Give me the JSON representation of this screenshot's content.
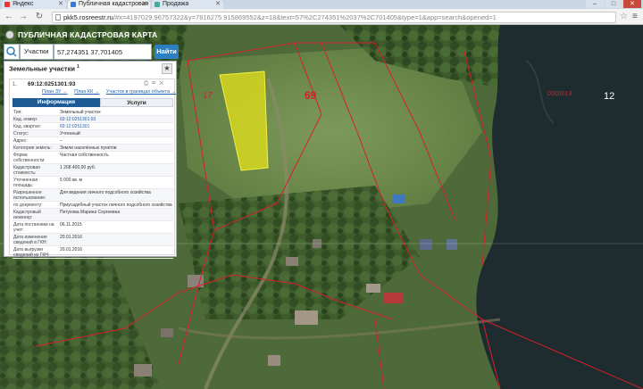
{
  "browser": {
    "tabs": [
      {
        "label": "Яндекс",
        "active": false
      },
      {
        "label": "Публичная кадастровая",
        "active": true
      },
      {
        "label": "Продажа",
        "active": false
      }
    ],
    "controls": {
      "minimize": "–",
      "maximize": "□",
      "close": "✕"
    },
    "url_host": "pkk5.rosreestr.ru",
    "url_rest": "/#x=4197029.96757322&y=7816275.915869552&z=18&text=57%2C274351%2037%2C701405&type=1&app=search&opened=1"
  },
  "map_header": {
    "title": "ПУБЛИЧНАЯ КАДАСТРОВАЯ КАРТА"
  },
  "search": {
    "type": "Участки ▾",
    "value": "57,274351 37,701405",
    "button": "Найти"
  },
  "panel": {
    "title": "Земельные участки",
    "count": "1",
    "object": {
      "num": "1.",
      "id": "69:12:0251301:93",
      "tools": "⎙ ✉ ✕",
      "links": [
        "План ЗУ →",
        "План КК →",
        "Участок в границах объекта →"
      ]
    },
    "tabs": {
      "info": "Информация",
      "services": "Услуги"
    },
    "attributes": [
      {
        "label": "Тип:",
        "value": "Земельный участок"
      },
      {
        "label": "Кад. номер:",
        "value": "69:12:0251301:93",
        "link": true
      },
      {
        "label": "Кад. квартал:",
        "value": "69:12:0251301",
        "link": true
      },
      {
        "label": "Статус:",
        "value": "Учтенный"
      },
      {
        "label": "Адрес:",
        "value": "–"
      },
      {
        "label": "Категория земель:",
        "value": "Земли населённых пунктов"
      },
      {
        "label": "Форма собственности:",
        "value": "Частная собственность"
      },
      {
        "label": "Кадастровая стоимость:",
        "value": "1 268 400,00 руб."
      },
      {
        "label": "Уточненная площадь:",
        "value": "5 000 кв. м"
      },
      {
        "label": "Разрешенное использование:",
        "value": "Для ведения личного подсобного хозяйства"
      },
      {
        "label": "по документу:",
        "value": "Приусадебный участок личного подсобного хозяйства"
      },
      {
        "label": "Кадастровый инженер:",
        "value": "Петухова Марина Сергеевна"
      },
      {
        "label": "Дата постановки на учет:",
        "value": "06.11.2015"
      },
      {
        "label": "Дата изменения сведений в ГКН:",
        "value": "20.01.2016"
      },
      {
        "label": "Дата выгрузки сведений из ГКН:",
        "value": "20.01.2016"
      }
    ]
  },
  "map": {
    "labels": {
      "parcel_69": "69",
      "parcel_12_right": "12",
      "parcel_17": "17",
      "code_right": "0000013"
    }
  },
  "colors": {
    "accent": "#2d7fc4",
    "parcel_fill": "#e6e21a",
    "boundary": "#d6202a",
    "tab_active": "#1e5a94"
  }
}
